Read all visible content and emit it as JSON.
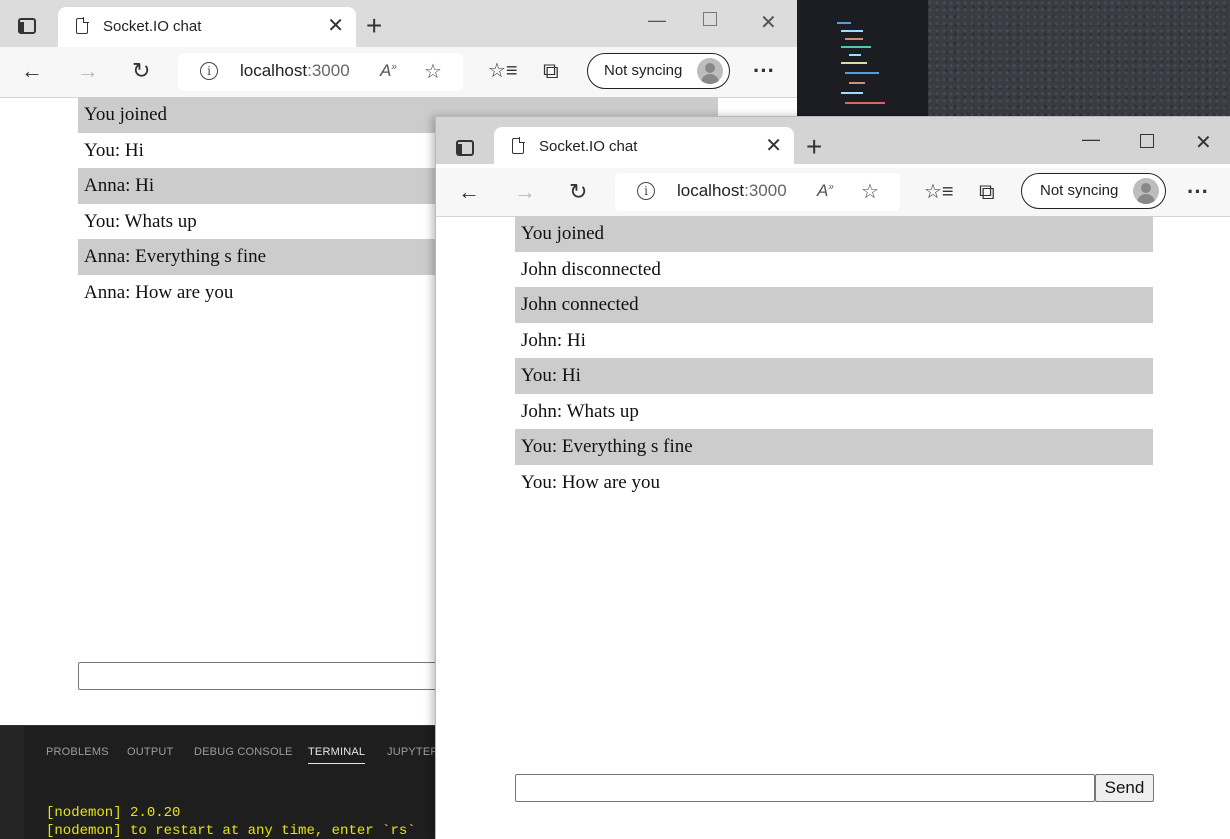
{
  "back_window": {
    "tab_title": "Socket.IO chat",
    "url_host": "localhost",
    "url_port": ":3000",
    "sync_label": "Not syncing",
    "messages": [
      "You joined",
      "You: Hi",
      "Anna: Hi",
      "You: Whats up",
      "Anna: Everything s fine",
      "Anna: How are you"
    ],
    "input_value": ""
  },
  "front_window": {
    "tab_title": "Socket.IO chat",
    "url_host": "localhost",
    "url_port": ":3000",
    "sync_label": "Not syncing",
    "messages": [
      "You joined",
      "John disconnected",
      "John connected",
      "John: Hi",
      "You: Hi",
      "John: Whats up",
      "You: Everything s fine",
      "You: How are you"
    ],
    "input_value": "",
    "send_label": "Send"
  },
  "vscode_panel": {
    "tabs": [
      "PROBLEMS",
      "OUTPUT",
      "DEBUG CONSOLE",
      "TERMINAL",
      "JUPYTER"
    ],
    "active_tab": "TERMINAL",
    "terminal_lines": [
      "[nodemon] 2.0.20",
      "[nodemon] to restart at any time, enter `rs`"
    ]
  },
  "icons": {
    "tab_actions": "tab-actions-icon",
    "document": "document-icon",
    "close": "close-icon",
    "new_tab": "plus-icon",
    "back": "arrow-left-icon",
    "forward": "arrow-right-icon",
    "refresh": "refresh-icon",
    "info": "info-icon",
    "read_aloud": "read-aloud-icon",
    "add_favorite": "star-plus-icon",
    "favorites": "favorites-icon",
    "collections": "collections-icon",
    "more": "more-icon"
  },
  "colors": {
    "odd_row_bg": "#cccccc",
    "terminal_text": "#e5e510"
  }
}
